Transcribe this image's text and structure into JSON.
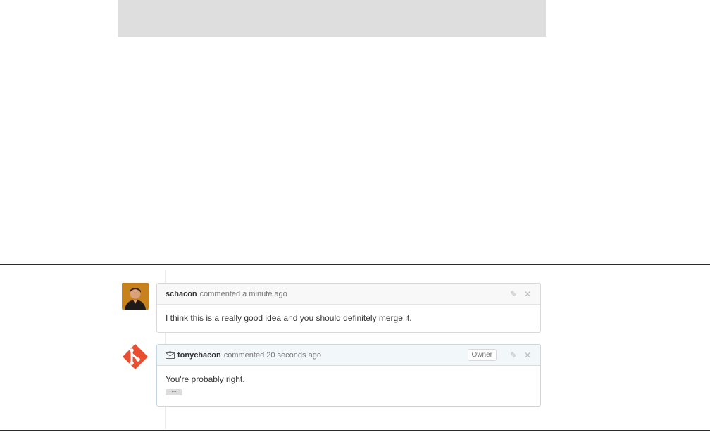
{
  "comments": [
    {
      "author": "schacon",
      "meta": "commented a minute ago",
      "body": "I think this is a really good idea and you should definitely merge it.",
      "avatar_icon": "profile-photo"
    },
    {
      "author": "tonychacon",
      "meta": "commented 20 seconds ago",
      "body": "You're probably right.",
      "badge": "Owner",
      "ellipsis": "…",
      "avatar_icon": "git-logo-icon",
      "via_icon": "mail-icon"
    }
  ],
  "colors": {
    "git_logo": "#e94e31",
    "header_bg": "#f8f8f8",
    "owner_header_bg": "#f2f8fa",
    "top_bar": "#dedede"
  },
  "icons": {
    "edit": "pencil-icon",
    "close": "close-icon"
  }
}
